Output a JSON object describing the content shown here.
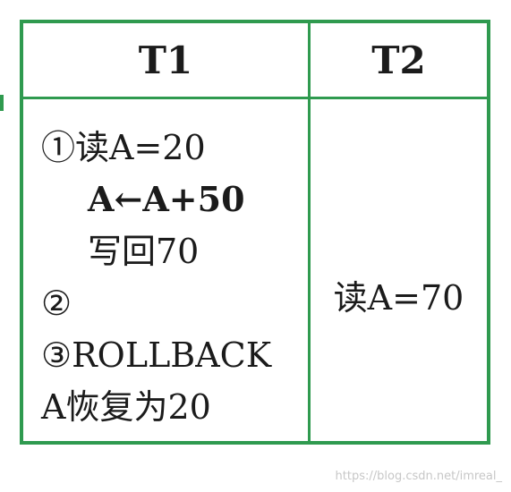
{
  "table": {
    "headers": [
      "T1",
      "T2"
    ],
    "t1_lines": [
      "①读A=20",
      "A←A+50",
      "写回70",
      "②",
      "③ROLLBACK",
      "A恢复为20"
    ],
    "t2_value": "读A=70"
  },
  "watermark": "https://blog.csdn.net/imreal_",
  "colors": {
    "border": "#2f9a4f",
    "text": "#1b1b1b",
    "watermark": "#c7c7c7"
  }
}
